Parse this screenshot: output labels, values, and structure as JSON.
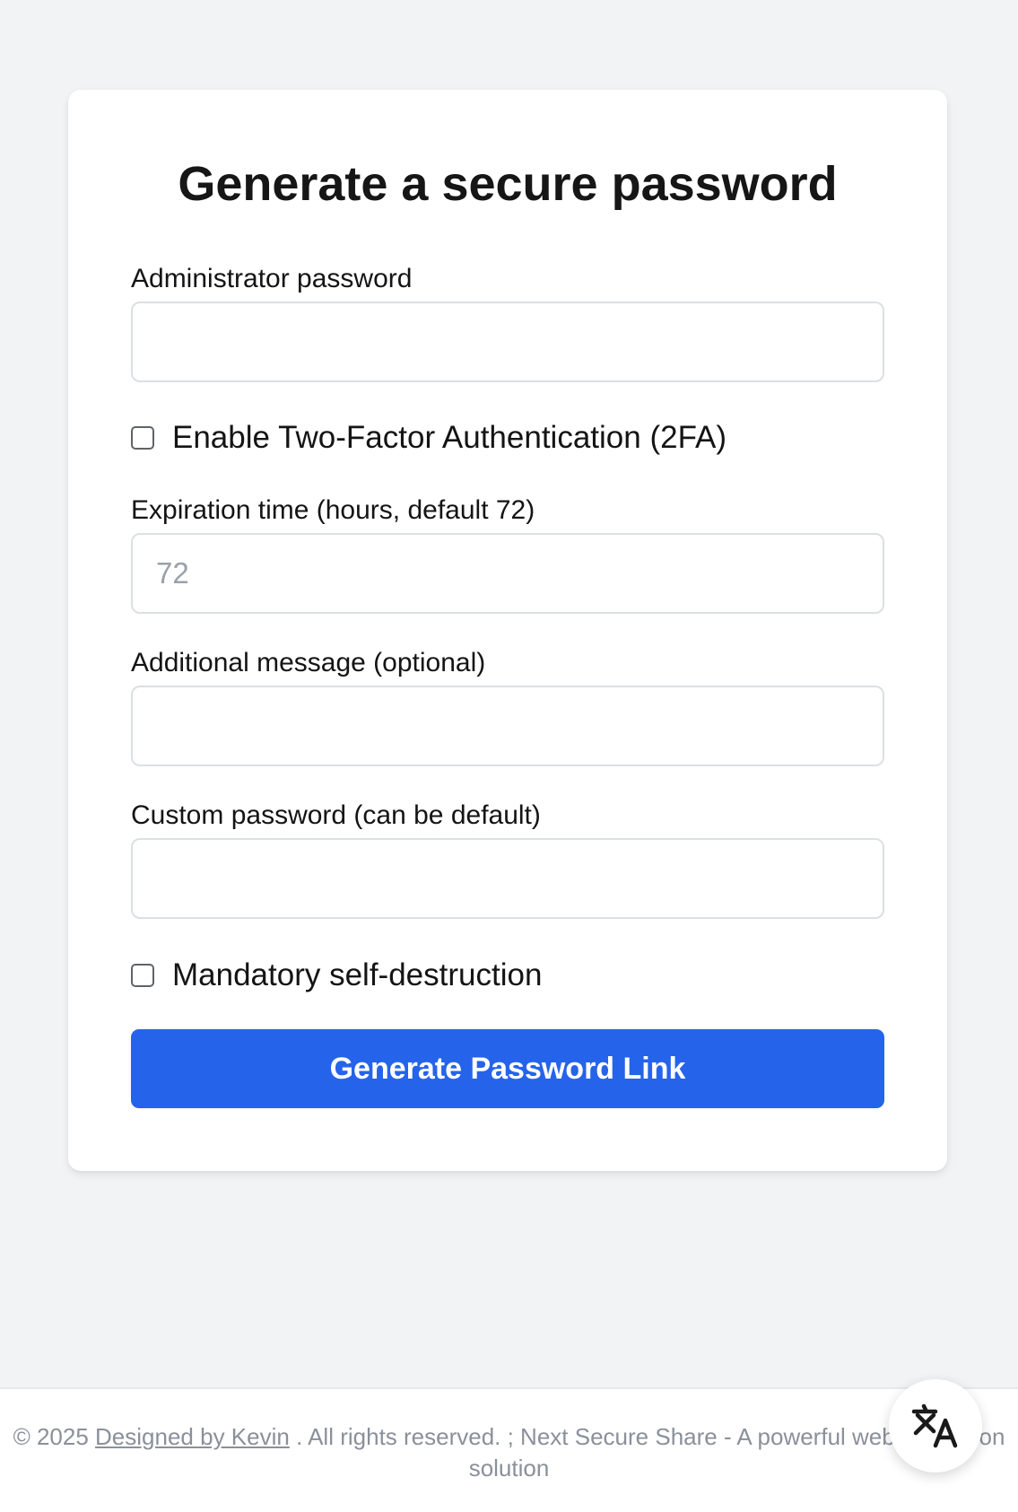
{
  "form": {
    "title": "Generate a secure password",
    "admin_password": {
      "label": "Administrator password",
      "value": "",
      "placeholder": ""
    },
    "two_factor": {
      "label": "Enable Two-Factor Authentication (2FA)",
      "checked": false
    },
    "expiration": {
      "label": "Expiration time (hours, default 72)",
      "value": "",
      "placeholder": "72"
    },
    "message": {
      "label": "Additional message (optional)",
      "value": "",
      "placeholder": ""
    },
    "custom_password": {
      "label": "Custom password (can be default)",
      "value": "",
      "placeholder": ""
    },
    "self_destruct": {
      "label": "Mandatory self-destruction",
      "checked": false
    },
    "submit_label": "Generate Password Link"
  },
  "footer": {
    "copyright": "© 2025",
    "designer_link": "Designed by Kevin",
    "rights": ". All rights reserved. ; Next Secure Share - A powerful web",
    "rights_tail": "ion",
    "line2": "solution"
  },
  "translate_button": {
    "icon": "translate-icon"
  },
  "colors": {
    "accent": "#2563eb",
    "background": "#f2f3f5",
    "card": "#ffffff",
    "muted_text": "#8a909a"
  }
}
